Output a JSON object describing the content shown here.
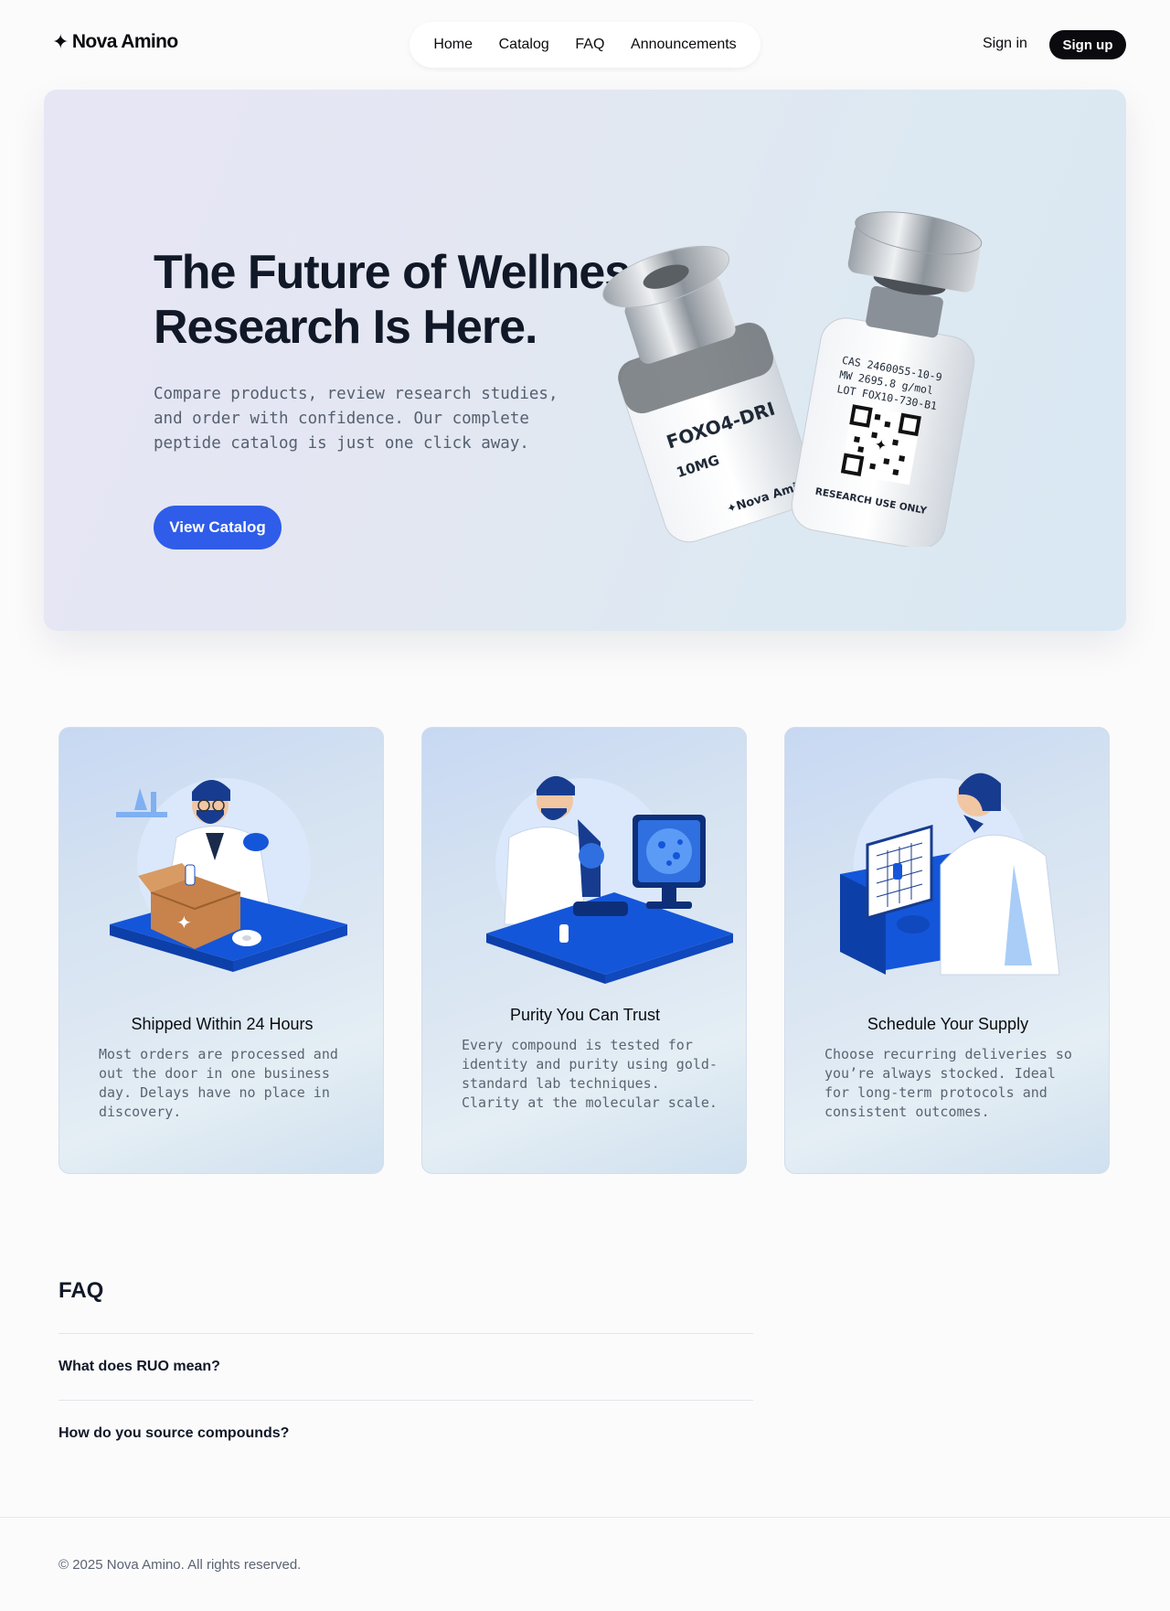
{
  "brand": {
    "logo_text": "Nova Amino",
    "logo_icon": "sparkle-icon"
  },
  "nav": {
    "items": [
      {
        "label": "Home"
      },
      {
        "label": "Catalog"
      },
      {
        "label": "FAQ"
      },
      {
        "label": "Announcements"
      }
    ]
  },
  "auth": {
    "signin_label": "Sign in",
    "signup_label": "Sign up"
  },
  "hero": {
    "title_line1": "The Future of Wellness",
    "title_line2": "Research Is Here.",
    "subtitle": "Compare products, review research studies, and order with confidence. Our complete peptide catalog is just one click away.",
    "cta_label": "View Catalog",
    "vial_left": {
      "name": "FOXO4-DRI",
      "dose": "10MG",
      "brand": "✦Nova Amino"
    },
    "vial_right": {
      "cas": "CAS 2460055-10-9",
      "mw": "MW 2695.8 g/mol",
      "lot": "LOT FOX10-730-B1",
      "note": "RESEARCH USE ONLY"
    }
  },
  "features": [
    {
      "title": "Shipped Within 24 Hours",
      "text": "Most orders are processed and out the door in one business day. Delays have no place in discovery.",
      "icon": "scientist-packing-box-illustration"
    },
    {
      "title": "Purity You Can Trust",
      "text": "Every compound is tested for identity and purity using gold-standard lab techniques. Clarity at the molecular scale.",
      "icon": "scientist-microscope-illustration"
    },
    {
      "title": "Schedule Your Supply",
      "text": "Choose recurring deliveries so you’re always stocked. Ideal for long-term protocols and consistent outcomes.",
      "icon": "scientist-calendar-illustration"
    }
  ],
  "faq": {
    "heading": "FAQ",
    "items": [
      {
        "question": "What does RUO mean?"
      },
      {
        "question": "How do you source compounds?"
      }
    ]
  },
  "footer": {
    "copyright": "© 2025 Nova Amino. All rights reserved."
  },
  "colors": {
    "accent": "#2f5de9",
    "dark": "#0b0b0f",
    "illustration_blue": "#1456d9"
  }
}
